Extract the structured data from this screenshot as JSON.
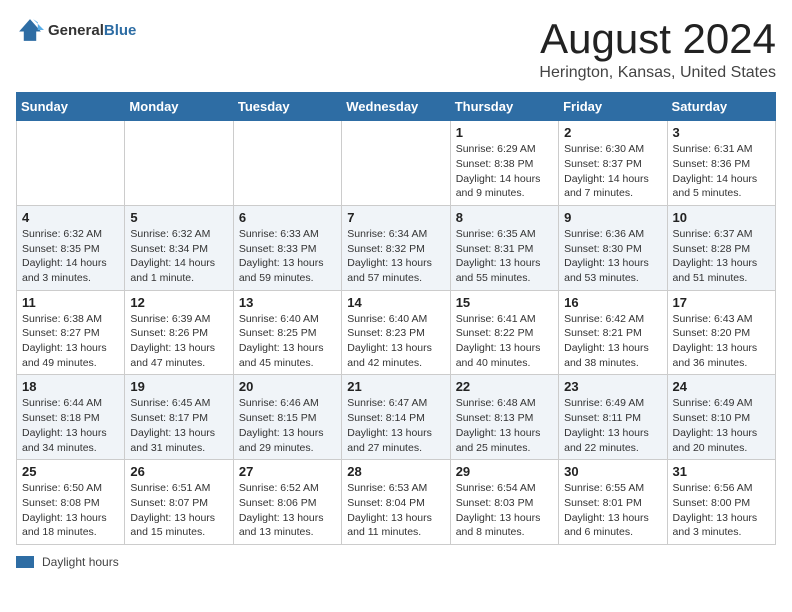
{
  "header": {
    "logo_general": "General",
    "logo_blue": "Blue",
    "month_title": "August 2024",
    "location": "Herington, Kansas, United States"
  },
  "days_of_week": [
    "Sunday",
    "Monday",
    "Tuesday",
    "Wednesday",
    "Thursday",
    "Friday",
    "Saturday"
  ],
  "weeks": [
    [
      {
        "day": "",
        "info": ""
      },
      {
        "day": "",
        "info": ""
      },
      {
        "day": "",
        "info": ""
      },
      {
        "day": "",
        "info": ""
      },
      {
        "day": "1",
        "info": "Sunrise: 6:29 AM\nSunset: 8:38 PM\nDaylight: 14 hours and 9 minutes."
      },
      {
        "day": "2",
        "info": "Sunrise: 6:30 AM\nSunset: 8:37 PM\nDaylight: 14 hours and 7 minutes."
      },
      {
        "day": "3",
        "info": "Sunrise: 6:31 AM\nSunset: 8:36 PM\nDaylight: 14 hours and 5 minutes."
      }
    ],
    [
      {
        "day": "4",
        "info": "Sunrise: 6:32 AM\nSunset: 8:35 PM\nDaylight: 14 hours and 3 minutes."
      },
      {
        "day": "5",
        "info": "Sunrise: 6:32 AM\nSunset: 8:34 PM\nDaylight: 14 hours and 1 minute."
      },
      {
        "day": "6",
        "info": "Sunrise: 6:33 AM\nSunset: 8:33 PM\nDaylight: 13 hours and 59 minutes."
      },
      {
        "day": "7",
        "info": "Sunrise: 6:34 AM\nSunset: 8:32 PM\nDaylight: 13 hours and 57 minutes."
      },
      {
        "day": "8",
        "info": "Sunrise: 6:35 AM\nSunset: 8:31 PM\nDaylight: 13 hours and 55 minutes."
      },
      {
        "day": "9",
        "info": "Sunrise: 6:36 AM\nSunset: 8:30 PM\nDaylight: 13 hours and 53 minutes."
      },
      {
        "day": "10",
        "info": "Sunrise: 6:37 AM\nSunset: 8:28 PM\nDaylight: 13 hours and 51 minutes."
      }
    ],
    [
      {
        "day": "11",
        "info": "Sunrise: 6:38 AM\nSunset: 8:27 PM\nDaylight: 13 hours and 49 minutes."
      },
      {
        "day": "12",
        "info": "Sunrise: 6:39 AM\nSunset: 8:26 PM\nDaylight: 13 hours and 47 minutes."
      },
      {
        "day": "13",
        "info": "Sunrise: 6:40 AM\nSunset: 8:25 PM\nDaylight: 13 hours and 45 minutes."
      },
      {
        "day": "14",
        "info": "Sunrise: 6:40 AM\nSunset: 8:23 PM\nDaylight: 13 hours and 42 minutes."
      },
      {
        "day": "15",
        "info": "Sunrise: 6:41 AM\nSunset: 8:22 PM\nDaylight: 13 hours and 40 minutes."
      },
      {
        "day": "16",
        "info": "Sunrise: 6:42 AM\nSunset: 8:21 PM\nDaylight: 13 hours and 38 minutes."
      },
      {
        "day": "17",
        "info": "Sunrise: 6:43 AM\nSunset: 8:20 PM\nDaylight: 13 hours and 36 minutes."
      }
    ],
    [
      {
        "day": "18",
        "info": "Sunrise: 6:44 AM\nSunset: 8:18 PM\nDaylight: 13 hours and 34 minutes."
      },
      {
        "day": "19",
        "info": "Sunrise: 6:45 AM\nSunset: 8:17 PM\nDaylight: 13 hours and 31 minutes."
      },
      {
        "day": "20",
        "info": "Sunrise: 6:46 AM\nSunset: 8:15 PM\nDaylight: 13 hours and 29 minutes."
      },
      {
        "day": "21",
        "info": "Sunrise: 6:47 AM\nSunset: 8:14 PM\nDaylight: 13 hours and 27 minutes."
      },
      {
        "day": "22",
        "info": "Sunrise: 6:48 AM\nSunset: 8:13 PM\nDaylight: 13 hours and 25 minutes."
      },
      {
        "day": "23",
        "info": "Sunrise: 6:49 AM\nSunset: 8:11 PM\nDaylight: 13 hours and 22 minutes."
      },
      {
        "day": "24",
        "info": "Sunrise: 6:49 AM\nSunset: 8:10 PM\nDaylight: 13 hours and 20 minutes."
      }
    ],
    [
      {
        "day": "25",
        "info": "Sunrise: 6:50 AM\nSunset: 8:08 PM\nDaylight: 13 hours and 18 minutes."
      },
      {
        "day": "26",
        "info": "Sunrise: 6:51 AM\nSunset: 8:07 PM\nDaylight: 13 hours and 15 minutes."
      },
      {
        "day": "27",
        "info": "Sunrise: 6:52 AM\nSunset: 8:06 PM\nDaylight: 13 hours and 13 minutes."
      },
      {
        "day": "28",
        "info": "Sunrise: 6:53 AM\nSunset: 8:04 PM\nDaylight: 13 hours and 11 minutes."
      },
      {
        "day": "29",
        "info": "Sunrise: 6:54 AM\nSunset: 8:03 PM\nDaylight: 13 hours and 8 minutes."
      },
      {
        "day": "30",
        "info": "Sunrise: 6:55 AM\nSunset: 8:01 PM\nDaylight: 13 hours and 6 minutes."
      },
      {
        "day": "31",
        "info": "Sunrise: 6:56 AM\nSunset: 8:00 PM\nDaylight: 13 hours and 3 minutes."
      }
    ]
  ],
  "footer": {
    "legend_label": "Daylight hours"
  }
}
